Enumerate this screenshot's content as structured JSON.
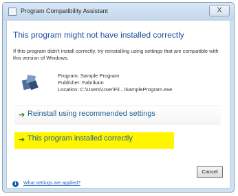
{
  "window": {
    "title": "Program Compatibility Assistant",
    "close_glyph": "X"
  },
  "main": {
    "instruction": "This program might not have installed correctly",
    "description": "If this program didn't install correctly, try reinstalling using settings that are compatible with this version of Windows.",
    "program": {
      "name": "Program: Sample Program",
      "publisher": "Publisher: Fabrikam",
      "location": "Location: C:\\Users\\User\\Fil...\\SampleProgram.exe"
    },
    "commands": [
      {
        "label": "Reinstall using recommended settings",
        "arrow": "➔"
      },
      {
        "label": "This program installed correctly",
        "arrow": "➔"
      }
    ],
    "cancel_label": "Cancel"
  },
  "footer": {
    "info_glyph": "i",
    "link": "What settings are applied?"
  },
  "colors": {
    "highlight": "#fff500",
    "instruction": "#1f4fa3",
    "command": "#1e5f93"
  }
}
